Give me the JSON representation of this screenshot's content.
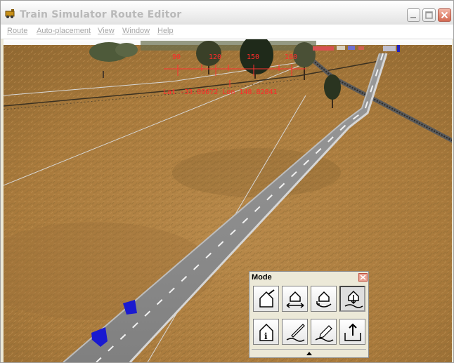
{
  "window": {
    "title": "Train Simulator Route Editor",
    "icon": "train-app-icon",
    "controls": [
      "minimize-icon",
      "maximize-icon",
      "close-icon"
    ]
  },
  "menu": {
    "items": [
      {
        "label": "Route"
      },
      {
        "label": "Auto-placement"
      },
      {
        "label": "View"
      },
      {
        "label": "Window"
      },
      {
        "label": "Help"
      }
    ]
  },
  "compass": {
    "headings": [
      "90",
      "120",
      "150",
      "180"
    ],
    "coordinates": "Lat -33.09672 Lon 148.82841",
    "color": "#ff0000"
  },
  "mode_palette": {
    "title": "Mode",
    "buttons": [
      {
        "icon": "place-object-icon",
        "active": false
      },
      {
        "icon": "move-object-icon",
        "active": false
      },
      {
        "icon": "rotate-object-icon",
        "active": false
      },
      {
        "icon": "raise-lower-object-icon",
        "active": true
      },
      {
        "icon": "object-info-icon",
        "active": false
      },
      {
        "icon": "terrain-paint-icon",
        "active": false
      },
      {
        "icon": "terrain-pencil-icon",
        "active": false
      },
      {
        "icon": "terrain-raise-icon",
        "active": false
      }
    ]
  }
}
